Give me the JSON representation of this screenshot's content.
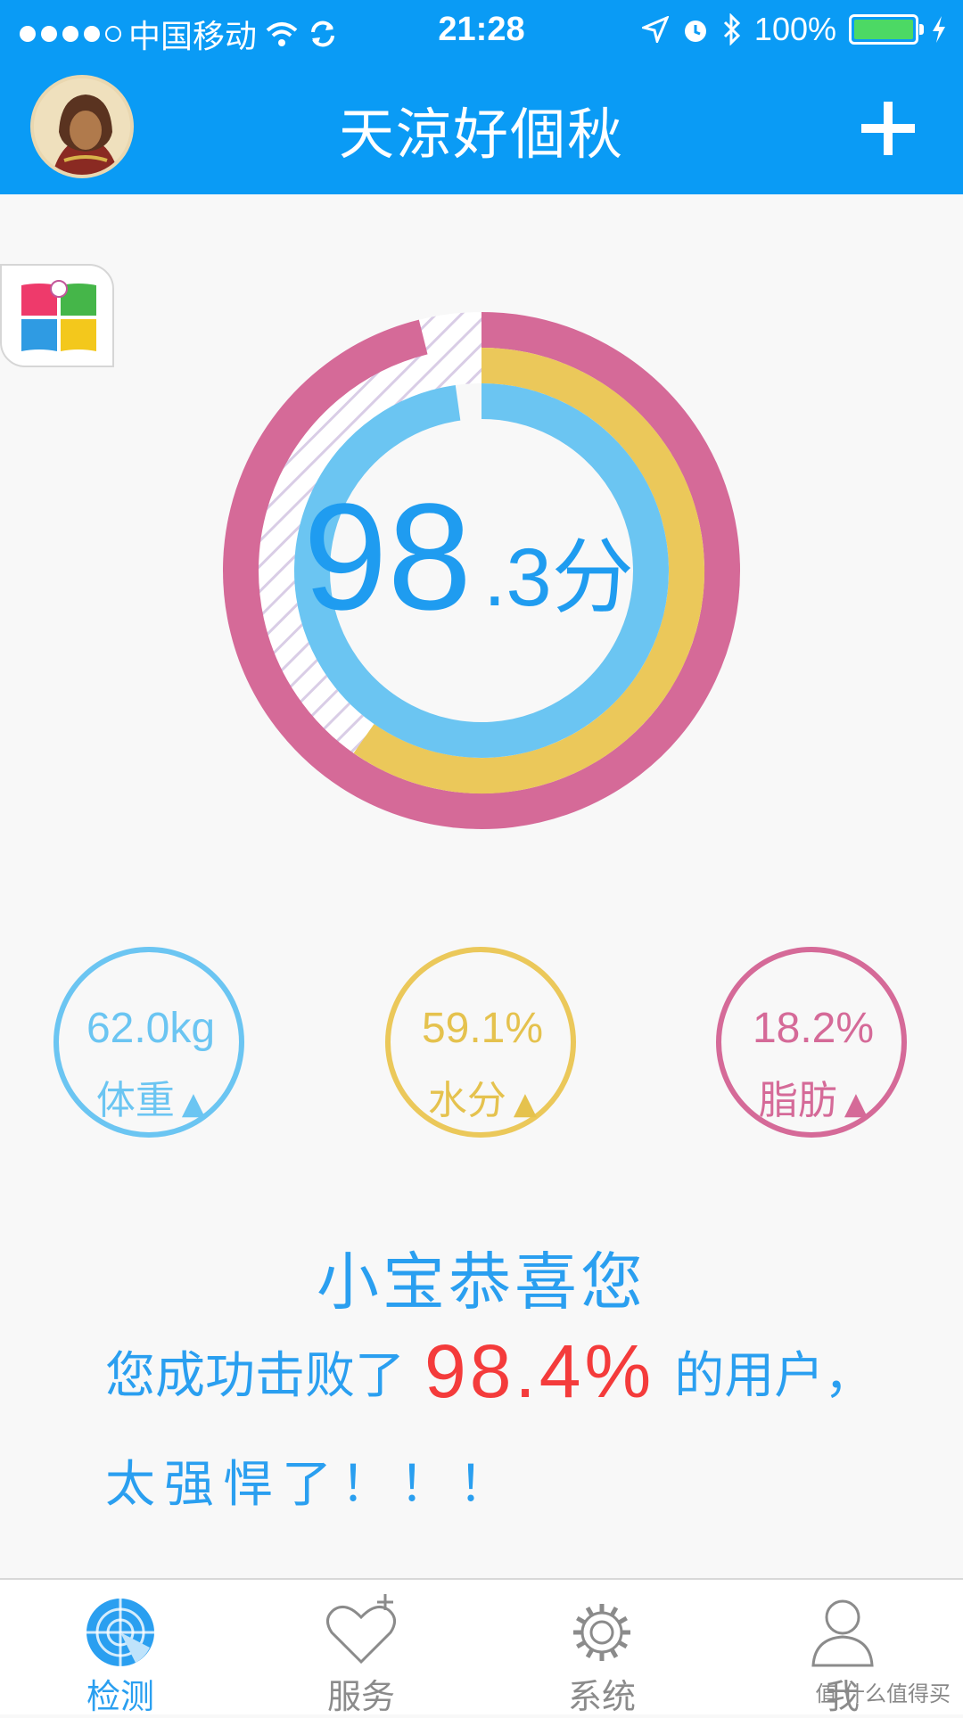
{
  "status_bar": {
    "carrier": "中国移动",
    "time": "21:28",
    "battery": "100%"
  },
  "header": {
    "title": "天涼好個秋"
  },
  "score": {
    "integer": "98",
    "decimal_unit": ".3分"
  },
  "metrics": [
    {
      "value": "62.0kg",
      "label": "体重",
      "trend": "up",
      "color": "#6bc5f2"
    },
    {
      "value": "59.1%",
      "label": "水分",
      "trend": "up",
      "color": "#ebc85a"
    },
    {
      "value": "18.2%",
      "label": "脂肪",
      "trend": "up",
      "color": "#d56a98"
    }
  ],
  "message": {
    "title": "小宝恭喜您",
    "prefix": "您成功击败了",
    "percent": "98.4%",
    "suffix": "的用户，",
    "line2": "太强悍了！！！"
  },
  "tabs": [
    {
      "label": "检测",
      "icon": "radar-icon",
      "active": true
    },
    {
      "label": "服务",
      "icon": "heart-plus-icon",
      "active": false
    },
    {
      "label": "系统",
      "icon": "gear-icon",
      "active": false
    },
    {
      "label": "我",
      "icon": "person-icon",
      "active": false
    }
  ],
  "watermark": "值 什么值得买"
}
